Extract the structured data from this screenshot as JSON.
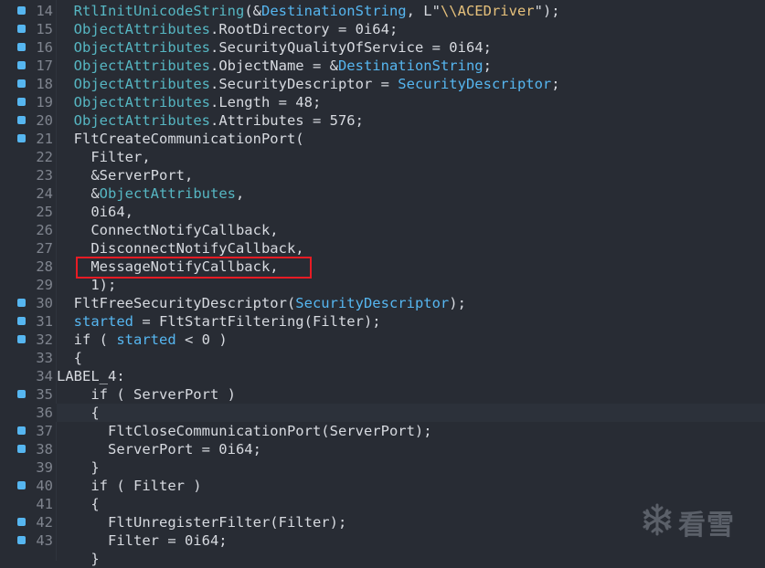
{
  "editor": {
    "lines": [
      {
        "n": "14",
        "bp": true,
        "tokens": [
          [
            "  ",
            ""
          ],
          [
            "RtlInitUnicodeString",
            "id"
          ],
          [
            "(&",
            ""
          ],
          [
            "DestinationString",
            "var"
          ],
          [
            ", L\"",
            ""
          ],
          [
            "\\\\ACEDriver",
            "str"
          ],
          [
            "\");",
            ""
          ]
        ]
      },
      {
        "n": "15",
        "bp": true,
        "tokens": [
          [
            "  ",
            ""
          ],
          [
            "ObjectAttributes",
            "id"
          ],
          [
            ".RootDirectory = 0i64;",
            ""
          ]
        ]
      },
      {
        "n": "16",
        "bp": true,
        "tokens": [
          [
            "  ",
            ""
          ],
          [
            "ObjectAttributes",
            "id"
          ],
          [
            ".SecurityQualityOfService = 0i64;",
            ""
          ]
        ]
      },
      {
        "n": "17",
        "bp": true,
        "tokens": [
          [
            "  ",
            ""
          ],
          [
            "ObjectAttributes",
            "id"
          ],
          [
            ".ObjectName = &",
            ""
          ],
          [
            "DestinationString",
            "var"
          ],
          [
            ";",
            ""
          ]
        ]
      },
      {
        "n": "18",
        "bp": true,
        "tokens": [
          [
            "  ",
            ""
          ],
          [
            "ObjectAttributes",
            "id"
          ],
          [
            ".SecurityDescriptor = ",
            ""
          ],
          [
            "SecurityDescriptor",
            "var"
          ],
          [
            ";",
            ""
          ]
        ]
      },
      {
        "n": "19",
        "bp": true,
        "tokens": [
          [
            "  ",
            ""
          ],
          [
            "ObjectAttributes",
            "id"
          ],
          [
            ".Length = 48;",
            ""
          ]
        ]
      },
      {
        "n": "20",
        "bp": true,
        "tokens": [
          [
            "  ",
            ""
          ],
          [
            "ObjectAttributes",
            "id"
          ],
          [
            ".Attributes = 576;",
            ""
          ]
        ]
      },
      {
        "n": "21",
        "bp": true,
        "tokens": [
          [
            "  FltCreateCommunicationPort(",
            ""
          ]
        ]
      },
      {
        "n": "22",
        "bp": false,
        "tokens": [
          [
            "    Filter,",
            ""
          ]
        ]
      },
      {
        "n": "23",
        "bp": false,
        "tokens": [
          [
            "    &ServerPort,",
            ""
          ]
        ]
      },
      {
        "n": "24",
        "bp": false,
        "tokens": [
          [
            "    &",
            ""
          ],
          [
            "ObjectAttributes",
            "id"
          ],
          [
            ",",
            ""
          ]
        ]
      },
      {
        "n": "25",
        "bp": false,
        "tokens": [
          [
            "    0i64,",
            ""
          ]
        ]
      },
      {
        "n": "26",
        "bp": false,
        "tokens": [
          [
            "    ConnectNotifyCallback,",
            ""
          ]
        ]
      },
      {
        "n": "27",
        "bp": false,
        "tokens": [
          [
            "    DisconnectNotifyCallback,",
            ""
          ]
        ]
      },
      {
        "n": "28",
        "bp": false,
        "tokens": [
          [
            "    MessageNotifyCallback,",
            ""
          ]
        ]
      },
      {
        "n": "29",
        "bp": false,
        "tokens": [
          [
            "    1);",
            ""
          ]
        ]
      },
      {
        "n": "30",
        "bp": true,
        "tokens": [
          [
            "  FltFreeSecurityDescriptor(",
            ""
          ],
          [
            "SecurityDescriptor",
            "var"
          ],
          [
            ");",
            ""
          ]
        ]
      },
      {
        "n": "31",
        "bp": true,
        "tokens": [
          [
            "  ",
            ""
          ],
          [
            "started",
            "var"
          ],
          [
            " = FltStartFiltering(Filter);",
            ""
          ]
        ]
      },
      {
        "n": "32",
        "bp": true,
        "tokens": [
          [
            "  if ( ",
            ""
          ],
          [
            "started",
            "var"
          ],
          [
            " < 0 )",
            ""
          ]
        ]
      },
      {
        "n": "33",
        "bp": false,
        "tokens": [
          [
            "  {",
            ""
          ]
        ]
      },
      {
        "n": "34",
        "bp": false,
        "tokens": [
          [
            "LABEL_4:",
            ""
          ]
        ],
        "label": true
      },
      {
        "n": "35",
        "bp": true,
        "tokens": [
          [
            "    if ( ServerPort )",
            ""
          ]
        ]
      },
      {
        "n": "36",
        "bp": false,
        "tokens": [
          [
            "    {",
            ""
          ]
        ],
        "hl": true
      },
      {
        "n": "37",
        "bp": true,
        "tokens": [
          [
            "      FltCloseCommunicationPort(ServerPort);",
            ""
          ]
        ]
      },
      {
        "n": "38",
        "bp": true,
        "tokens": [
          [
            "      ServerPort = 0i64;",
            ""
          ]
        ]
      },
      {
        "n": "39",
        "bp": false,
        "tokens": [
          [
            "    }",
            ""
          ]
        ]
      },
      {
        "n": "40",
        "bp": true,
        "tokens": [
          [
            "    if ( Filter )",
            ""
          ]
        ]
      },
      {
        "n": "41",
        "bp": false,
        "tokens": [
          [
            "    {",
            ""
          ]
        ]
      },
      {
        "n": "42",
        "bp": true,
        "tokens": [
          [
            "      FltUnregisterFilter(Filter);",
            ""
          ]
        ]
      },
      {
        "n": "43",
        "bp": true,
        "tokens": [
          [
            "      Filter = 0i64;",
            ""
          ]
        ]
      },
      {
        "n": "",
        "bp": false,
        "tokens": [
          [
            "    }",
            ""
          ]
        ]
      }
    ]
  },
  "colors": {
    "identifier": "#56b6c2",
    "variable": "#56b6f0",
    "string": "#e5c07b",
    "highlight_box": "#e81b24"
  },
  "watermark": {
    "text": "看雪",
    "icon": "snowflake-icon"
  }
}
